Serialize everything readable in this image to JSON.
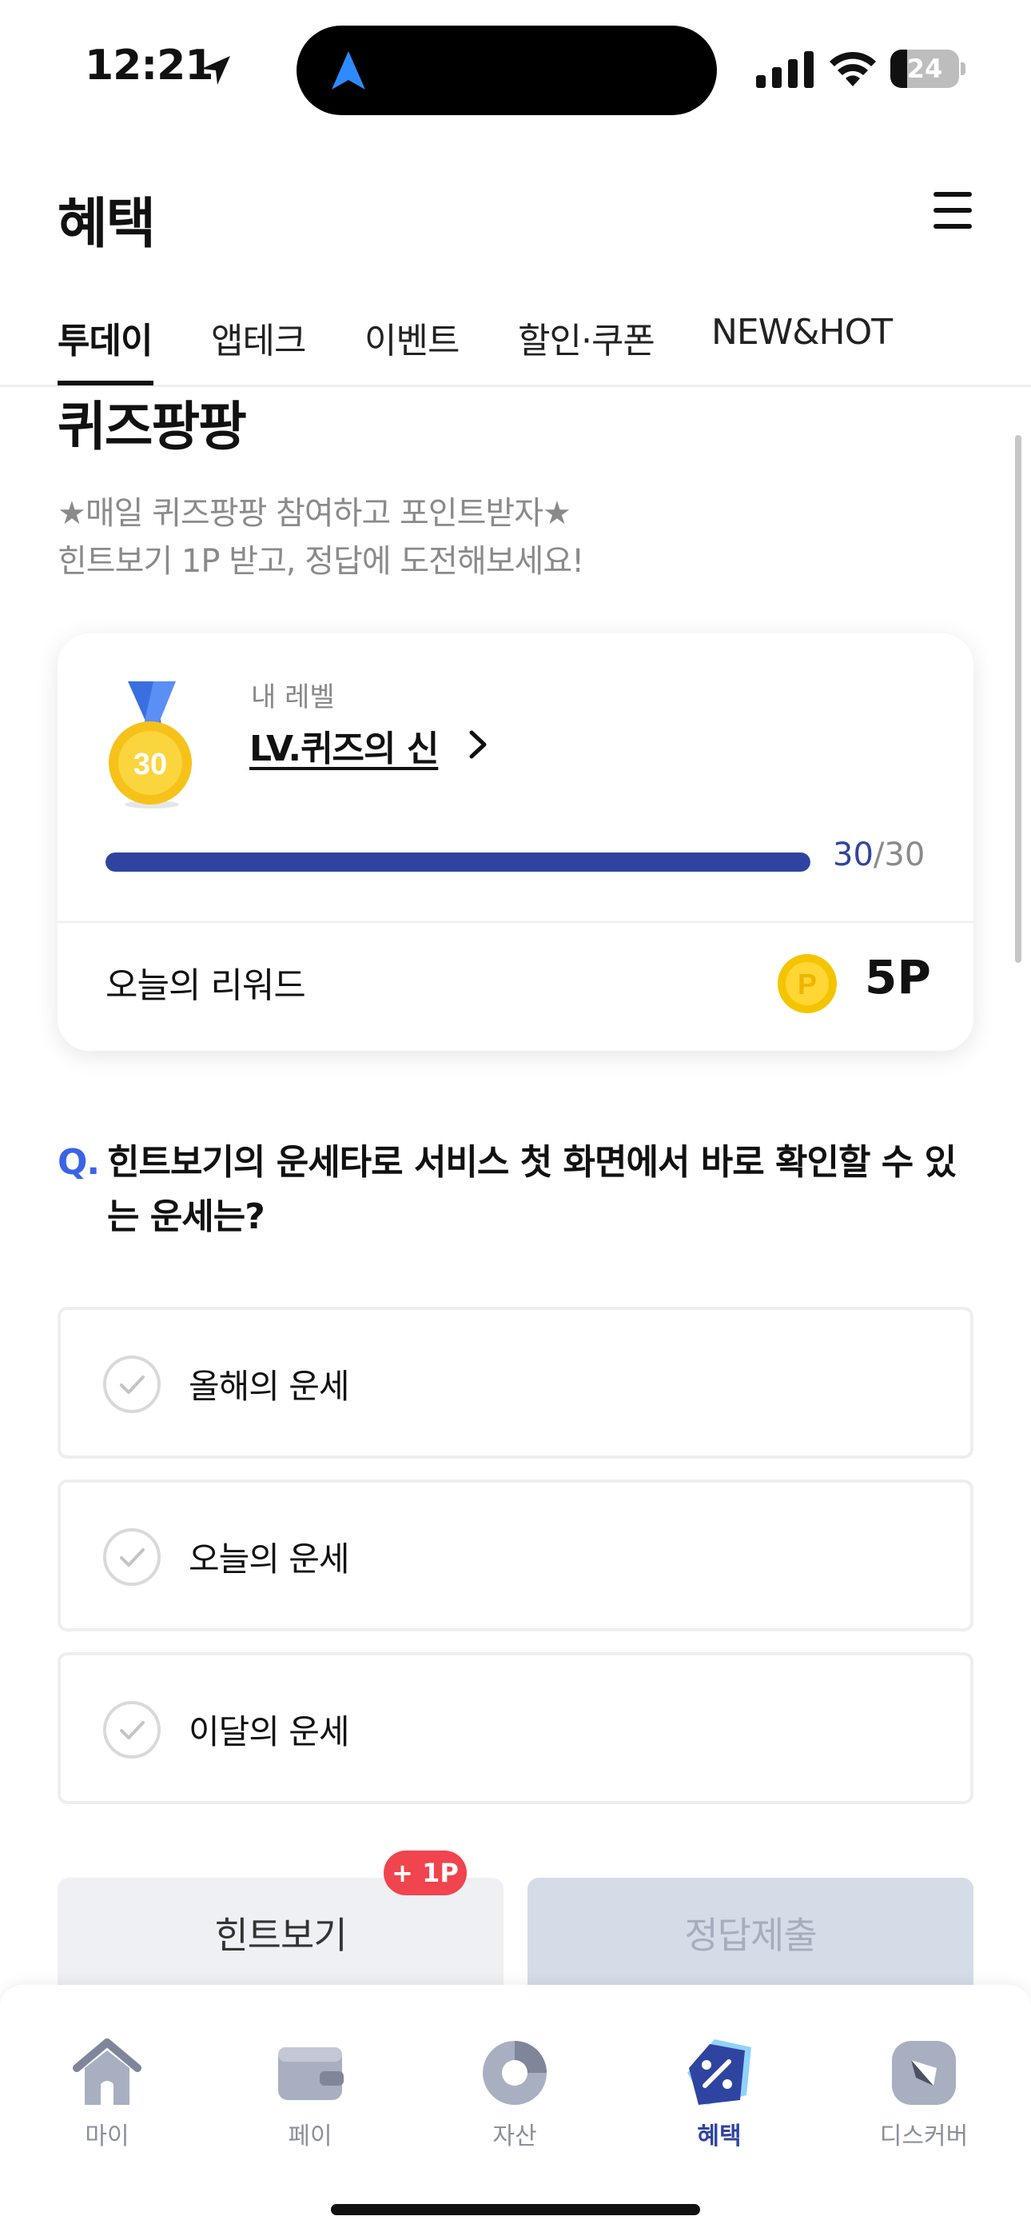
{
  "status_bar": {
    "time": "12:21",
    "battery_percent": "24",
    "battery_level": 0.24
  },
  "header": {
    "title": "혜택"
  },
  "tabs": [
    {
      "label": "투데이",
      "active": true
    },
    {
      "label": "앱테크",
      "active": false
    },
    {
      "label": "이벤트",
      "active": false
    },
    {
      "label": "할인·쿠폰",
      "active": false
    },
    {
      "label": "NEW&HOT",
      "active": false
    }
  ],
  "section": {
    "title": "퀴즈팡팡",
    "desc_line1": "★매일 퀴즈팡팡 참여하고 포인트받자★",
    "desc_line2": "힌트보기 1P 받고, 정답에 도전해보세요!"
  },
  "level_card": {
    "medal_number": "30",
    "label": "내 레벨",
    "name": "LV.퀴즈의 신",
    "progress_current": "30",
    "progress_separator": "/",
    "progress_max": "30",
    "progress_fraction": 1.0,
    "reward_label": "오늘의 리워드",
    "reward_coin_symbol": "P",
    "reward_value": "5P"
  },
  "question": {
    "prefix": "Q.",
    "text": "힌트보기의 운세타로 서비스 첫 화면에서 바로 확인할 수 있는 운세는?"
  },
  "options": [
    {
      "label": "올해의 운세"
    },
    {
      "label": "오늘의 운세"
    },
    {
      "label": "이달의 운세"
    }
  ],
  "actions": {
    "hint_label": "힌트보기",
    "hint_badge": "+ 1P",
    "submit_label": "정답제출"
  },
  "bottom_nav": [
    {
      "label": "마이",
      "icon": "home-icon",
      "active": false
    },
    {
      "label": "페이",
      "icon": "wallet-icon",
      "active": false
    },
    {
      "label": "자산",
      "icon": "pie-chart-icon",
      "active": false
    },
    {
      "label": "혜택",
      "icon": "benefit-tag-icon",
      "active": true
    },
    {
      "label": "디스커버",
      "icon": "compass-icon",
      "active": false
    }
  ],
  "colors": {
    "accent": "#2f44a0",
    "question_prefix": "#3a63e8",
    "badge": "#f0444e",
    "coin": "#f5c400"
  }
}
